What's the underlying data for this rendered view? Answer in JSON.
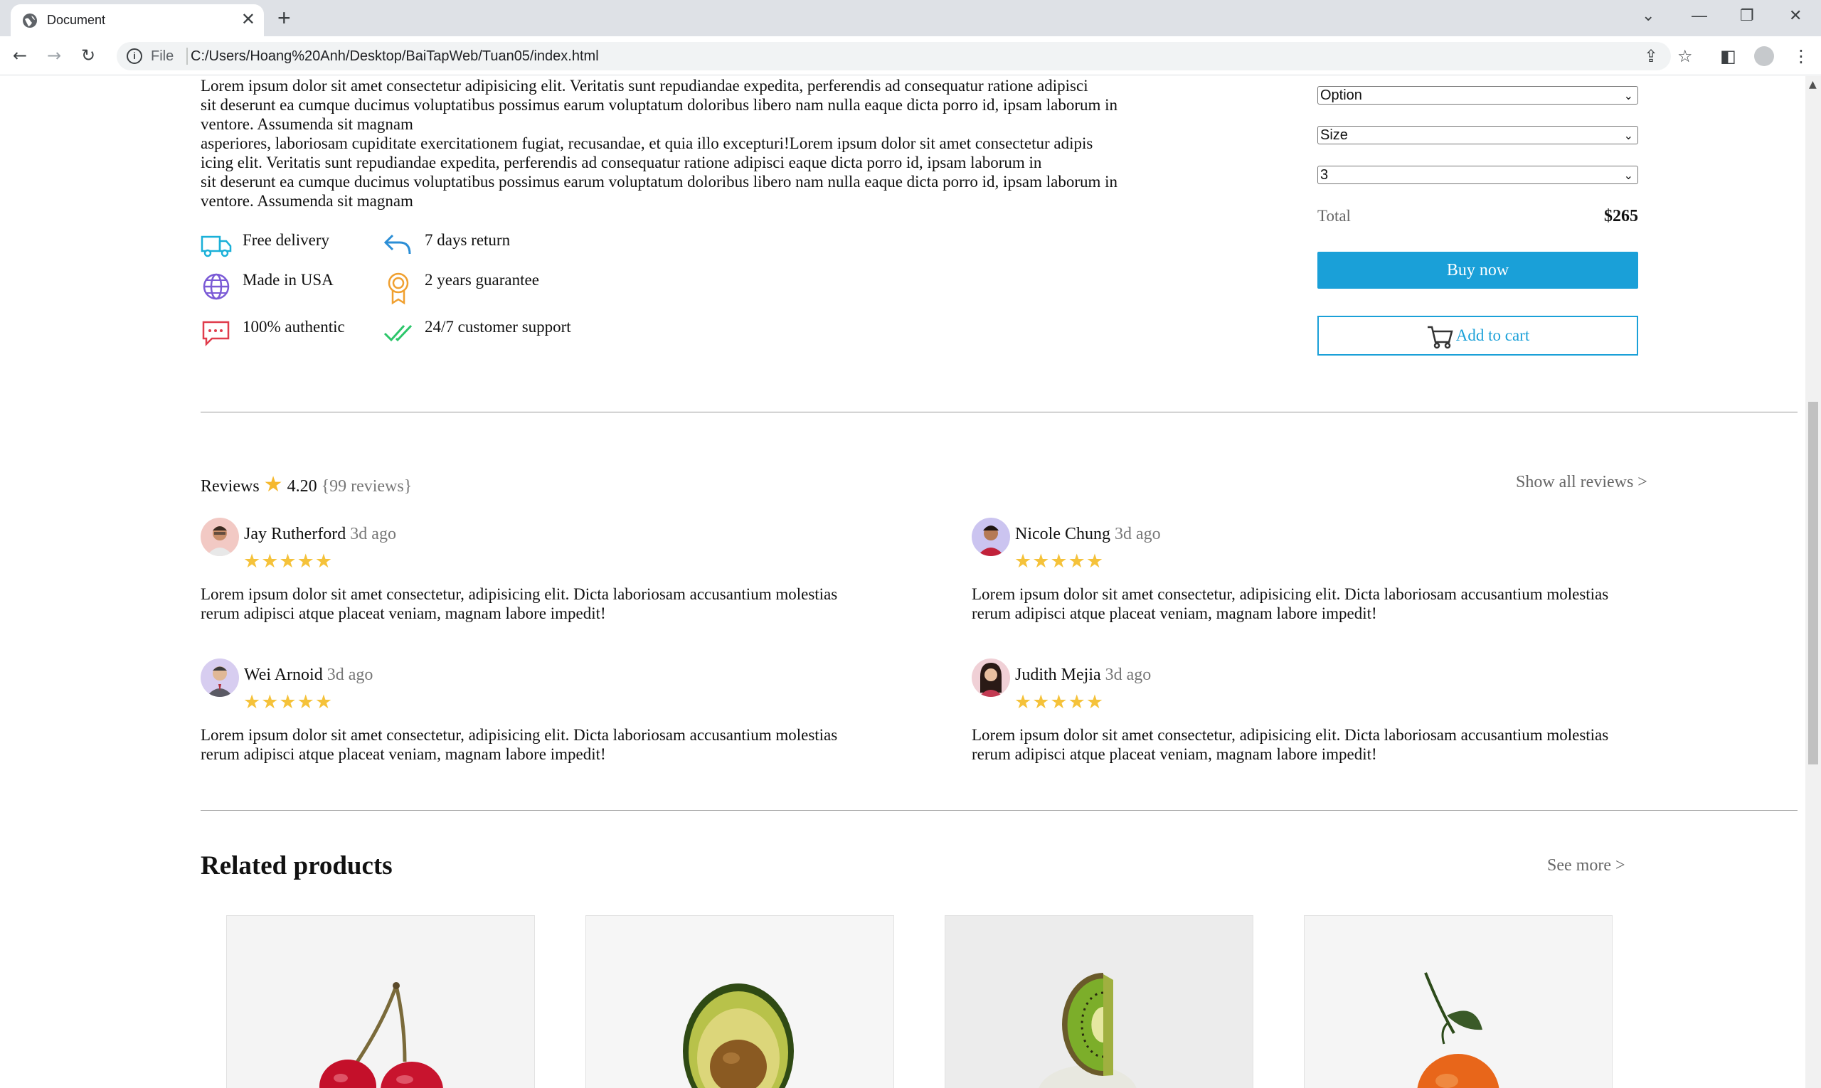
{
  "browser": {
    "tab_title": "Document",
    "tab_close": "✕",
    "new_tab": "+",
    "file_label": "File",
    "url": "C:/Users/Hoang%20Anh/Desktop/BaiTapWeb/Tuan05/index.html"
  },
  "product": {
    "description": [
      "Lorem ipsum dolor sit amet consectetur adipisicing elit. Veritatis sunt repudiandae expedita, perferendis ad consequatur ratione adipisci",
      "sit deserunt ea cumque ducimus voluptatibus possimus earum voluptatum doloribus libero nam nulla eaque dicta porro id, ipsam laborum in",
      "ventore. Assumenda sit magnam",
      "asperiores, laboriosam cupiditate exercitationem fugiat, recusandae, et quia illo excepturi!Lorem ipsum dolor sit amet consectetur adipis",
      "icing elit. Veritatis sunt repudiandae expedita, perferendis ad consequatur ratione adipisci eaque dicta porro id, ipsam laborum in",
      "sit deserunt ea cumque ducimus voluptatibus possimus earum voluptatum doloribus libero nam nulla eaque dicta porro id, ipsam laborum in",
      "ventore. Assumenda sit magnam"
    ],
    "features": [
      {
        "label": "Free delivery",
        "icon": "truck-icon",
        "color": "#1ab0d8"
      },
      {
        "label": "7 days return",
        "icon": "return-arrow-icon",
        "color": "#2b8ed6"
      },
      {
        "label": "Made in USA",
        "icon": "globe-icon",
        "color": "#7b5bd6"
      },
      {
        "label": "2 years guarantee",
        "icon": "award-ribbon-icon",
        "color": "#f0a030"
      },
      {
        "label": "100% authentic",
        "icon": "chat-bubble-icon",
        "color": "#e03c4c"
      },
      {
        "label": "24/7 customer support",
        "icon": "double-check-icon",
        "color": "#2cc66a"
      }
    ]
  },
  "purchase": {
    "option_select": "Option",
    "size_select": "Size",
    "quantity_select": "3",
    "total_label": "Total",
    "total_value": "$265",
    "buy_label": "Buy now",
    "cart_label": "Add to cart",
    "accent_color": "#1aa0d8"
  },
  "reviews": {
    "title": "Reviews",
    "rating": "4.20",
    "count": "{99 reviews}",
    "show_all": "Show all reviews   >",
    "items": [
      {
        "name": "Jay Rutherford",
        "ago": "3d ago",
        "stars": "★★★★★",
        "text": [
          "Lorem ipsum dolor sit amet consectetur, adipisicing elit. Dicta laboriosam accusantium molestias",
          "rerum adipisci atque placeat veniam, magnam labore impedit!"
        ]
      },
      {
        "name": "Nicole Chung",
        "ago": "3d ago",
        "stars": "★★★★★",
        "text": [
          "Lorem ipsum dolor sit amet consectetur, adipisicing elit. Dicta laboriosam accusantium molestias",
          "rerum adipisci atque placeat veniam, magnam labore impedit!"
        ]
      },
      {
        "name": "Wei Arnoid",
        "ago": "3d ago",
        "stars": "★★★★★",
        "text": [
          "Lorem ipsum dolor sit amet consectetur, adipisicing elit. Dicta laboriosam accusantium molestias",
          "rerum adipisci atque placeat veniam, magnam labore impedit!"
        ]
      },
      {
        "name": "Judith Mejia",
        "ago": "3d ago",
        "stars": "★★★★★",
        "text": [
          "Lorem ipsum dolor sit amet consectetur, adipisicing elit. Dicta laboriosam accusantium molestias",
          "rerum adipisci atque placeat veniam, magnam labore impedit!"
        ]
      }
    ]
  },
  "related": {
    "title": "Related products",
    "see_more": "See more   >",
    "items": [
      "cherry",
      "avocado",
      "kiwi",
      "orange"
    ]
  }
}
